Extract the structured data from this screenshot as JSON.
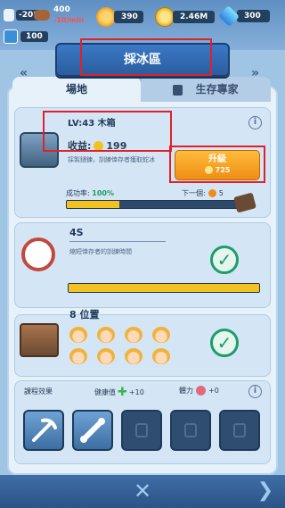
{
  "topbar": {
    "temperature": "-20°C",
    "wood_amount": "400",
    "wood_rate": "-10/min",
    "gear_amount": "390",
    "coins": "2.46M",
    "gems": "300",
    "population": "100"
  },
  "header": {
    "title": "採冰區"
  },
  "tabs": [
    {
      "label": "場地"
    },
    {
      "label": "生存專家"
    }
  ],
  "level_card": {
    "level_label": "LV:43 木箱",
    "income_label": "收益:",
    "income_value": "199",
    "description": "採製鏈鍊，訓練倖存者獲取蛇冰",
    "upgrade_label": "升級",
    "upgrade_cost": "725",
    "success_label": "成功率:",
    "success_value": "100%",
    "next_label": "下一個:",
    "next_value": "5",
    "progress": 0.3
  },
  "time_card": {
    "value": "4S",
    "description": "縮短倖存者的訓練時間",
    "progress": 1.0
  },
  "position_card": {
    "value": "8 位置",
    "face_count": 8
  },
  "course_card": {
    "label": "課程效果",
    "health_label": "健康值",
    "health_value": "+10",
    "stamina_label": "體力",
    "stamina_value": "+0"
  },
  "colors": {
    "accent": "#f2a51e",
    "success": "#1e9c6a",
    "panel": "#e7f1fa"
  },
  "icons": [
    "thermometer-icon",
    "wood-icon",
    "gear-icon",
    "coin-icon",
    "gem-icon",
    "survivor-icon",
    "info-icon",
    "lock-icon",
    "check-icon",
    "close-icon",
    "arrow-right-icon"
  ]
}
